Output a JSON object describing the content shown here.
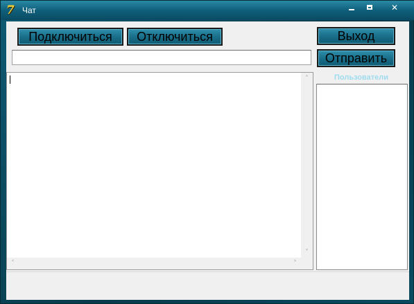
{
  "window": {
    "title": "Чат",
    "icon": "app-logo-icon",
    "minimize_glyph": "",
    "maximize_glyph": "",
    "close_glyph": "✕"
  },
  "toolbar": {
    "connect_label": "Подключиться",
    "disconnect_label": "Отключиться",
    "exit_label": "Выход",
    "send_label": "Отправить"
  },
  "message_input": {
    "value": "",
    "placeholder": ""
  },
  "chat": {
    "text": ""
  },
  "users": {
    "label": "Пользователи",
    "items": []
  },
  "status": {
    "text": ""
  },
  "colors": {
    "button": "#1a6f8a",
    "frame": "#0b4a5e",
    "users_label": "#9fdcf0"
  }
}
